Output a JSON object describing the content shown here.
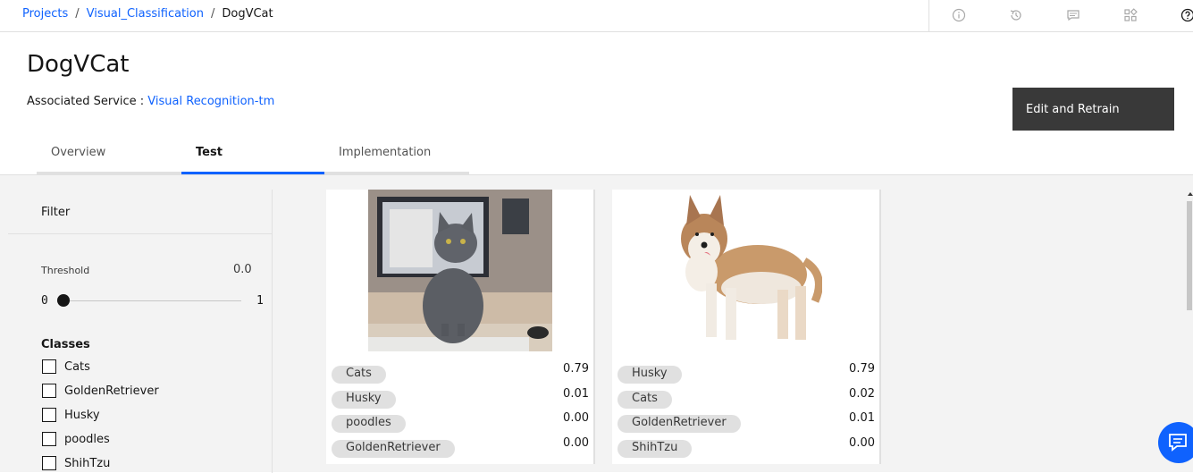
{
  "breadcrumb": {
    "projects": "Projects",
    "sep": "/",
    "visual_classification": "Visual_Classification",
    "current": "DogVCat"
  },
  "topbar_icons": [
    "info-icon",
    "history-icon",
    "comment-icon",
    "apps-icon",
    "help-icon"
  ],
  "page": {
    "title": "DogVCat",
    "assoc_label": "Associated Service :",
    "assoc_service": "Visual Recognition-tm",
    "retrain_label": "Edit and Retrain"
  },
  "tabs": [
    {
      "label": "Overview",
      "active": false
    },
    {
      "label": "Test",
      "active": true
    },
    {
      "label": "Implementation",
      "active": false
    }
  ],
  "sidebar": {
    "filter": "Filter",
    "threshold_label": "Threshold",
    "threshold_value": "0.0",
    "slider_min": "0",
    "slider_max": "1",
    "classes_heading": "Classes",
    "classes": [
      "Cats",
      "GoldenRetriever",
      "Husky",
      "poodles",
      "ShihTzu"
    ]
  },
  "results": [
    {
      "image": "cat-photo",
      "scores": [
        {
          "label": "Cats",
          "score": "0.79"
        },
        {
          "label": "Husky",
          "score": "0.01"
        },
        {
          "label": "poodles",
          "score": "0.00"
        },
        {
          "label": "GoldenRetriever",
          "score": "0.00"
        }
      ]
    },
    {
      "image": "husky-photo",
      "scores": [
        {
          "label": "Husky",
          "score": "0.79"
        },
        {
          "label": "Cats",
          "score": "0.02"
        },
        {
          "label": "GoldenRetriever",
          "score": "0.01"
        },
        {
          "label": "ShihTzu",
          "score": "0.00"
        }
      ]
    }
  ],
  "colors": {
    "accent": "#0f62fe",
    "button_bg": "#393939",
    "pill_bg": "#e0e0e0",
    "panel_bg": "#f3f3f3"
  }
}
